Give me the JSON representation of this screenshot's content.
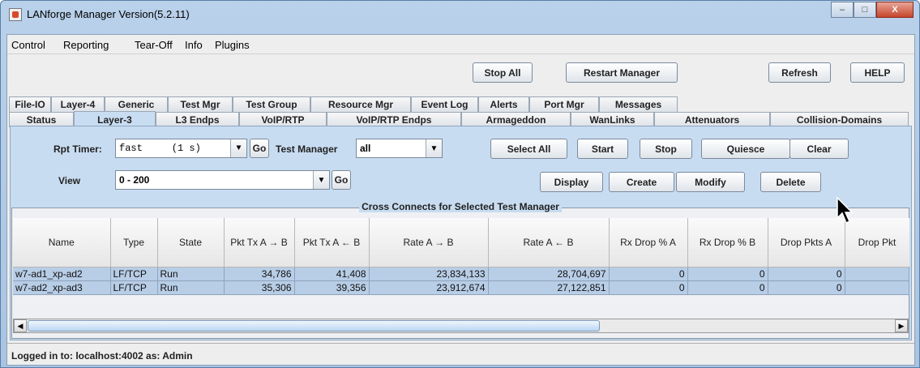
{
  "window": {
    "title": "LANforge Manager   Version(5.2.11)",
    "min": "–",
    "max": "□",
    "close": "X"
  },
  "menu": [
    "Control",
    "Reporting",
    "Tear-Off",
    "Info",
    "Plugins"
  ],
  "top_buttons": {
    "stop_all": "Stop All",
    "restart": "Restart Manager",
    "refresh": "Refresh",
    "help": "HELP"
  },
  "tabs_row1": [
    "File-IO",
    "Layer-4",
    "Generic",
    "Test Mgr",
    "Test Group",
    "Resource Mgr",
    "Event Log",
    "Alerts",
    "Port Mgr",
    "Messages"
  ],
  "tabs_row2": [
    "Status",
    "Layer-3",
    "L3 Endps",
    "VoIP/RTP",
    "VoIP/RTP Endps",
    "Armageddon",
    "WanLinks",
    "Attenuators",
    "Collision-Domains"
  ],
  "active_tab": "Layer-3",
  "controls": {
    "rpt_timer_label": "Rpt Timer:",
    "rpt_timer_value": "fast     (1 s)",
    "go1": "Go",
    "test_manager_label": "Test Manager",
    "test_manager_value": "all",
    "view_label": "View",
    "view_value": "0 - 200",
    "go2": "Go",
    "select_all": "Select All",
    "start": "Start",
    "stop": "Stop",
    "quiesce": "Quiesce",
    "clear": "Clear",
    "display": "Display",
    "create": "Create",
    "modify": "Modify",
    "delete": "Delete"
  },
  "table": {
    "title": "Cross Connects for Selected Test Manager",
    "columns": [
      "Name",
      "Type",
      "State",
      "Pkt Tx A → B",
      "Pkt Tx A ← B",
      "Rate A → B",
      "Rate A ← B",
      "Rx Drop % A",
      "Rx Drop % B",
      "Drop Pkts A",
      "Drop Pkt"
    ],
    "rows": [
      [
        "w7-ad1_xp-ad2",
        "LF/TCP",
        "Run",
        "34,786",
        "41,408",
        "23,834,133",
        "28,704,697",
        "0",
        "0",
        "0",
        ""
      ],
      [
        "w7-ad2_xp-ad3",
        "LF/TCP",
        "Run",
        "35,306",
        "39,356",
        "23,912,674",
        "27,122,851",
        "0",
        "0",
        "0",
        ""
      ]
    ]
  },
  "status_text": "Logged in to:  localhost:4002  as:  Admin"
}
